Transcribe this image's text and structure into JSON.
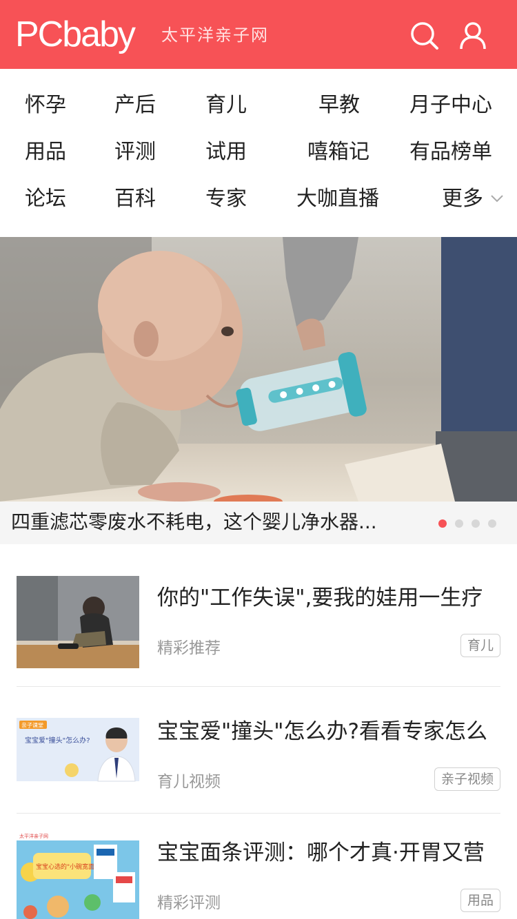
{
  "header": {
    "logo": "PCbaby",
    "tagline": "太平洋亲子网",
    "search_icon": "search-icon",
    "user_icon": "user-icon",
    "bg_color": "#f75256"
  },
  "nav": {
    "items": [
      "怀孕",
      "产后",
      "育儿",
      "早教",
      "月子中心",
      "用品",
      "评测",
      "试用",
      "嘻箱记",
      "有品榜单",
      "论坛",
      "百科",
      "专家",
      "大咖直播",
      "更多"
    ],
    "more_icon": "chevron-down-icon"
  },
  "hero": {
    "caption": "四重滤芯零废水不耗电，这个婴儿净水器...",
    "slide_count": 4,
    "active_slide": 1
  },
  "articles": [
    {
      "title": "你的\"工作失误\",要我的娃用一生疗",
      "source": "精彩推荐",
      "tag": "育儿"
    },
    {
      "title": "宝宝爱\"撞头\"怎么办?看看专家怎么",
      "source": "育儿视频",
      "tag": "亲子视频",
      "thumb_text": {
        "badge": "亲子课堂",
        "headline": "宝宝爱\"撞头\"怎么办?"
      }
    },
    {
      "title": "宝宝面条评测：哪个才真·开胃又营",
      "source": "精彩评测",
      "tag": "用品",
      "thumb_text": {
        "site": "太平洋亲子网",
        "headline": "宝宝心选的\"小碗宽面\""
      }
    }
  ]
}
